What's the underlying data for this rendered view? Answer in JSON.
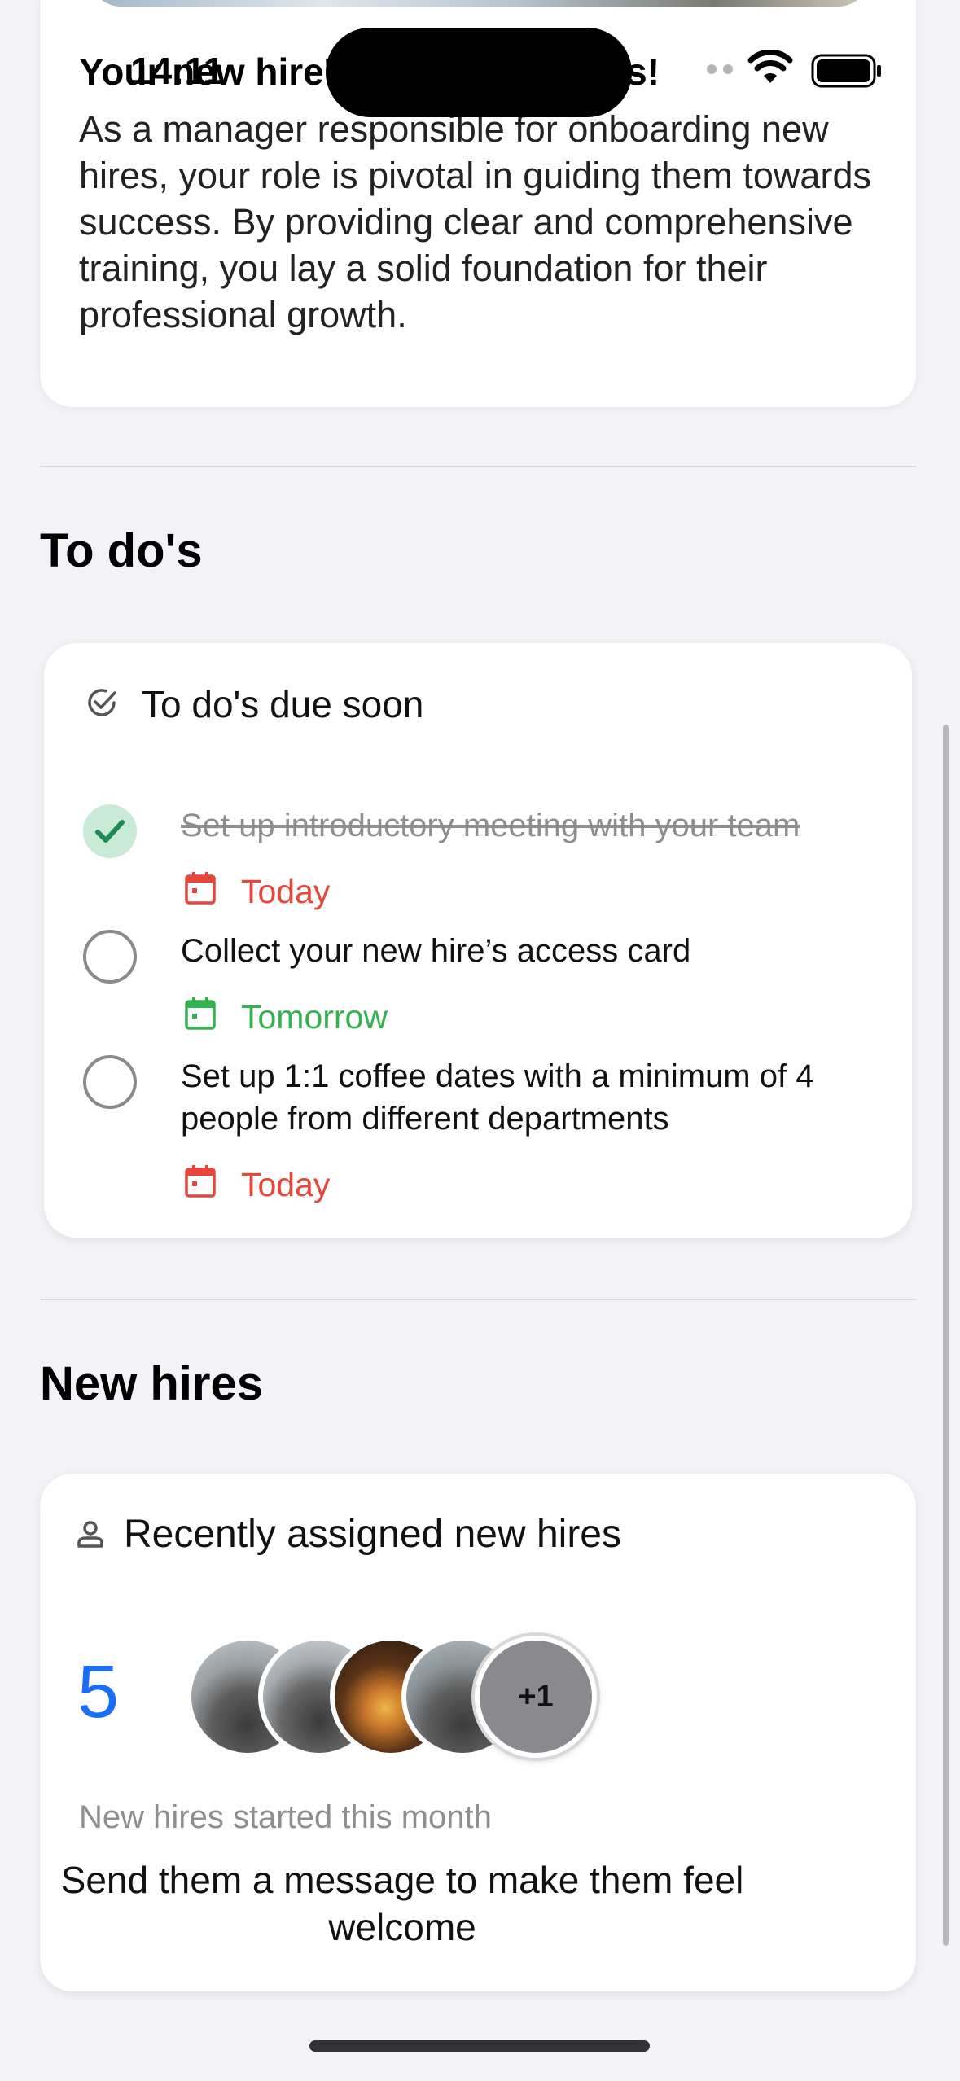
{
  "status_bar": {
    "time": "14:11"
  },
  "intro": {
    "heading": "Your new hire's path to success!",
    "body": "As a manager responsible for onboarding new hires, your role is pivotal in guiding them towards success. By providing clear and comprehensive training, you lay a solid foundation for their professional growth."
  },
  "todos": {
    "section_title": "To do's",
    "card_title": "To do's due soon",
    "items": [
      {
        "text": "Set up introductory meeting with your team",
        "due": "Today",
        "done": true
      },
      {
        "text": "Collect your new hire’s access card",
        "due": "Tomorrow",
        "done": false
      },
      {
        "text": "Set up 1:1 coffee dates with a minimum of 4 people from different departments",
        "due": "Today",
        "done": false
      }
    ]
  },
  "new_hires": {
    "section_title": "New hires",
    "card_title": "Recently assigned new hires",
    "count": "5",
    "more_badge": "+1",
    "subtext": "New hires started this month",
    "cta": "Send them a message to make them feel welcome"
  },
  "colors": {
    "accent_blue": "#1a6ef5",
    "due_today": "#e8463a",
    "due_tomorrow": "#34b24f",
    "check_done_bg": "#c9ead6",
    "check_done_mark": "#1f8a55"
  }
}
